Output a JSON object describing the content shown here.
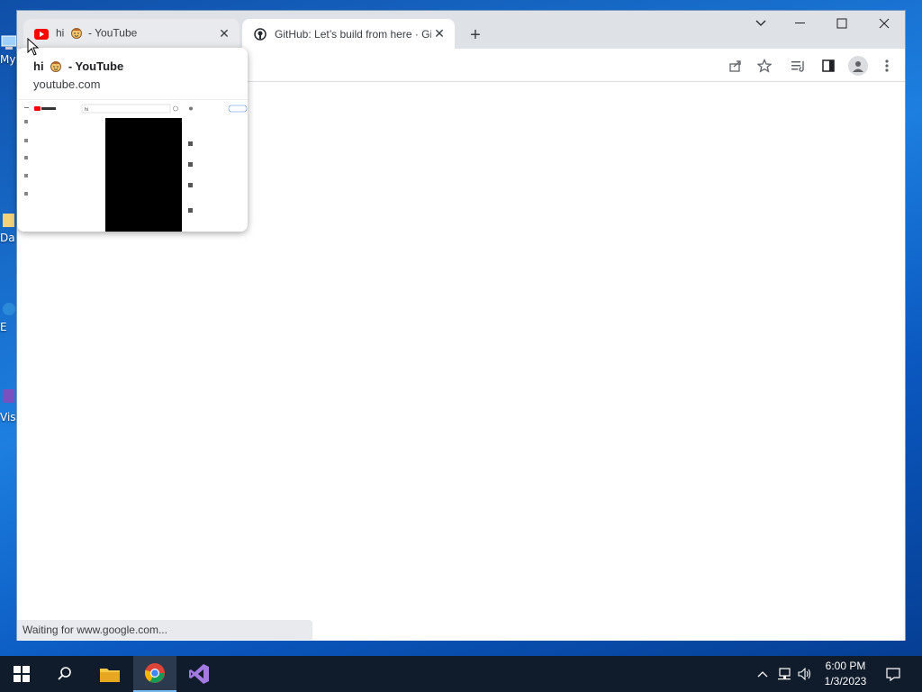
{
  "desktop": {
    "labels": [
      "My",
      "Da",
      "E",
      "Vis"
    ]
  },
  "browser": {
    "tabs": [
      {
        "title_prefix": "hi",
        "title_suffix": "- YouTube",
        "favicon": "youtube-icon",
        "active": false
      },
      {
        "title": "GitHub: Let’s build from here · GitHub",
        "favicon": "github-icon",
        "active": true
      }
    ],
    "hover_card": {
      "title_prefix": "hi",
      "title_suffix": "- YouTube",
      "url": "youtube.com",
      "preview_search_text": "hi"
    },
    "status_text": "Waiting for www.google.com..."
  },
  "taskbar": {
    "time": "6:00 PM",
    "date": "1/3/2023",
    "pinned": [
      "windows-start",
      "search",
      "file-explorer",
      "chrome",
      "visual-studio"
    ]
  },
  "colors": {
    "accent": "#1a73e8",
    "youtube_red": "#ff0000",
    "taskbar_bg": "#101c2c"
  }
}
